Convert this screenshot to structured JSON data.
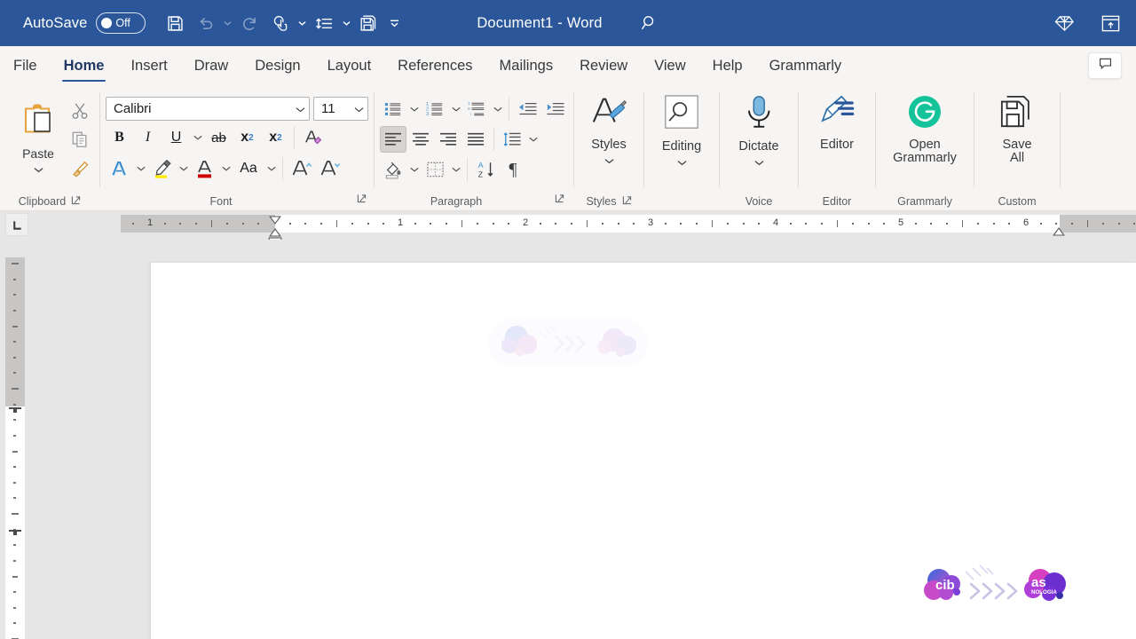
{
  "titlebar": {
    "autosave_label": "AutoSave",
    "autosave_state": "Off",
    "document_title": "Document1  -  Word",
    "quick_access": [
      {
        "name": "save",
        "label": "Save",
        "icon": "floppy-disk-icon",
        "disabled": false
      },
      {
        "name": "undo",
        "label": "Undo",
        "icon": "undo-arrow-icon",
        "disabled": true
      },
      {
        "name": "redo",
        "label": "Redo",
        "icon": "redo-arrow-icon",
        "disabled": true
      },
      {
        "name": "touch-mode",
        "label": "Touch/Mouse Mode",
        "icon": "touch-hand-icon",
        "disabled": false
      },
      {
        "name": "line-spacing",
        "label": "Line and Paragraph Spacing",
        "icon": "line-spacing-icon",
        "disabled": false
      },
      {
        "name": "save-all",
        "label": "Save All",
        "icon": "save-all-icon",
        "disabled": false
      },
      {
        "name": "customize-qat",
        "label": "Customize Quick Access Toolbar",
        "icon": "chevron-down-bar-icon",
        "disabled": false
      }
    ],
    "search_icon": "search-icon",
    "right_icons": [
      {
        "name": "diamond",
        "label": "Diamond",
        "icon": "diamond-icon"
      },
      {
        "name": "ribbon-display-options",
        "label": "Ribbon Display Options",
        "icon": "ribbon-display-icon"
      }
    ]
  },
  "tabs": [
    {
      "label": "File",
      "active": false
    },
    {
      "label": "Home",
      "active": true
    },
    {
      "label": "Insert",
      "active": false
    },
    {
      "label": "Draw",
      "active": false
    },
    {
      "label": "Design",
      "active": false
    },
    {
      "label": "Layout",
      "active": false
    },
    {
      "label": "References",
      "active": false
    },
    {
      "label": "Mailings",
      "active": false
    },
    {
      "label": "Review",
      "active": false
    },
    {
      "label": "View",
      "active": false
    },
    {
      "label": "Help",
      "active": false
    },
    {
      "label": "Grammarly",
      "active": false
    }
  ],
  "comments_button": {
    "label": "Comments",
    "icon": "comment-bubble-icon"
  },
  "ribbon": {
    "clipboard": {
      "group_label": "Clipboard",
      "paste_label": "Paste",
      "cut_label": "Cut",
      "copy_label": "Copy",
      "format_painter_label": "Format Painter",
      "dialog_launcher_label": "Clipboard settings"
    },
    "font": {
      "group_label": "Font",
      "font_name": "Calibri",
      "font_size": "11",
      "bold_label": "B",
      "italic_label": "I",
      "underline_label": "U",
      "strikethrough_label": "ab",
      "subscript_label": "x",
      "superscript_label": "x",
      "clear_formatting_label": "Clear All Formatting",
      "text_effects_label": "Text Effects and Typography",
      "highlight_label": "Text Highlight Color",
      "font_color_label": "Font Color",
      "change_case_label": "Aa",
      "grow_font_label": "Increase Font Size",
      "shrink_font_label": "Decrease Font Size",
      "dialog_launcher_label": "Font settings"
    },
    "paragraph": {
      "group_label": "Paragraph",
      "bullets_label": "Bullets",
      "numbering_label": "Numbering",
      "multilevel_label": "Multilevel List",
      "decrease_indent_label": "Decrease Indent",
      "increase_indent_label": "Increase Indent",
      "align_left_label": "Align Left",
      "align_center_label": "Center",
      "align_right_label": "Align Right",
      "justify_label": "Justify",
      "line_spacing_label": "Line and Paragraph Spacing",
      "shading_label": "Shading",
      "borders_label": "Borders",
      "sort_label": "Sort",
      "show_marks_label": "¶",
      "dialog_launcher_label": "Paragraph settings"
    },
    "styles": {
      "group_label": "Styles",
      "button_label": "Styles",
      "dialog_launcher_label": "Styles settings"
    },
    "editing": {
      "group_label": "",
      "button_label": "Editing"
    },
    "voice": {
      "group_label": "Voice",
      "button_label": "Dictate"
    },
    "editor": {
      "group_label": "Editor",
      "button_label": "Editor"
    },
    "grammarly": {
      "group_label": "Grammarly",
      "button_label_line1": "Open",
      "button_label_line2": "Grammarly"
    },
    "custom": {
      "group_label": "Custom",
      "button_label_line1": "Save",
      "button_label_line2": "All"
    }
  },
  "ruler": {
    "tab_stop_label": "Left Tab",
    "horizontal_numbers": [
      "1",
      "1",
      "2",
      "3",
      "4",
      "5",
      "6"
    ],
    "unit": "inches",
    "first_line_indent_label": "First Line Indent",
    "hanging_indent_label": "Hanging Indent",
    "right_indent_label": "Right Indent"
  },
  "document": {
    "page_label": "Page 1",
    "watermark_top_label": "cloud-arrows-graphic",
    "logo_bottom_label": "cib-tecnologias-logo",
    "content_text": ""
  },
  "colors": {
    "titlebar_blue": "#2b579a",
    "ribbon_bg": "#f7f5f4",
    "app_bg": "#e6e6e6",
    "page_white": "#ffffff",
    "accent_underline": "#2b579a",
    "grammarly_green": "#15c39a",
    "editor_blue": "#2b579a",
    "highlight_yellow": "#ffeb00",
    "font_color_red": "#d00000"
  }
}
